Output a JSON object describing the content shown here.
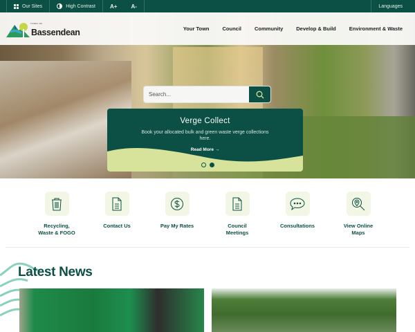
{
  "topbar": {
    "our_sites": "Our Sites",
    "high_contrast": "High Contrast",
    "font_increase": "A+",
    "font_decrease": "A-",
    "languages": "Languages"
  },
  "logo": {
    "town_of": "TOWN OF",
    "name": "Bassendean"
  },
  "nav": [
    "Your Town",
    "Council",
    "Community",
    "Develop & Build",
    "Environment & Waste"
  ],
  "search": {
    "placeholder": "Search..."
  },
  "slide": {
    "title": "Verge Collect",
    "text": "Book your allocated bulk and green waste verge collections here.",
    "link": "Read More →",
    "total": 2,
    "active": 2
  },
  "quick_links": [
    {
      "label": "Recycling, Waste & FOGO",
      "icon": "trash-icon"
    },
    {
      "label": "Contact Us",
      "icon": "document-icon"
    },
    {
      "label": "Pay My Rates",
      "icon": "dollar-icon"
    },
    {
      "label": "Council Meetings",
      "icon": "document-icon"
    },
    {
      "label": "Consultations",
      "icon": "speech-bubble-icon"
    },
    {
      "label": "View Online Maps",
      "icon": "map-search-icon"
    }
  ],
  "news": {
    "heading": "Latest News"
  },
  "colors": {
    "primary": "#0b4f45",
    "accent": "#d7e39a",
    "icon_bg": "#f2f6e4"
  }
}
